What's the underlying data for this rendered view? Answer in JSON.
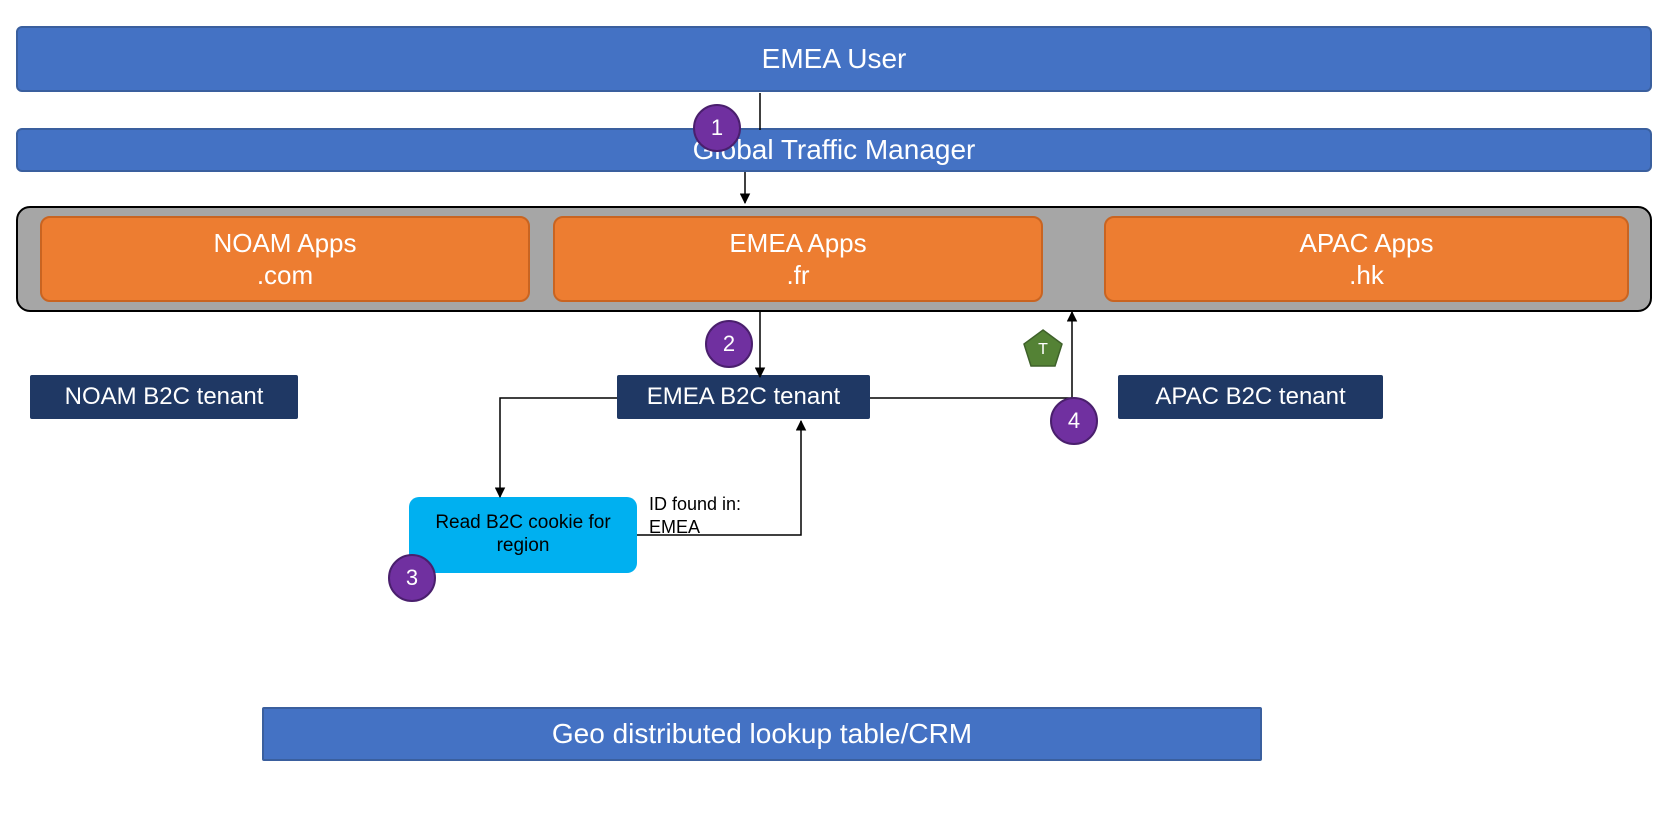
{
  "top_bars": {
    "user": "EMEA User",
    "gtm": "Global Traffic Manager"
  },
  "apps": {
    "noam": {
      "line1": "NOAM Apps",
      "line2": ".com"
    },
    "emea": {
      "line1": "EMEA Apps",
      "line2": ".fr"
    },
    "apac": {
      "line1": "APAC Apps",
      "line2": ".hk"
    }
  },
  "tenants": {
    "noam": "NOAM B2C tenant",
    "emea": "EMEA B2C tenant",
    "apac": "APAC B2C tenant"
  },
  "cookie_box": "Read B2C cookie for region",
  "annotation": {
    "line1": "ID found in:",
    "line2": "EMEA"
  },
  "steps": {
    "s1": "1",
    "s2": "2",
    "s3": "3",
    "s4": "4"
  },
  "token_badge": "T",
  "bottom_bar": "Geo distributed lookup table/CRM",
  "colors": {
    "blue": "#4472C4",
    "dark": "#1F3864",
    "orange": "#ED7D31",
    "gray": "#A6A6A6",
    "cyan": "#00B0F0",
    "purple": "#7030A0",
    "olive": "#548235"
  }
}
